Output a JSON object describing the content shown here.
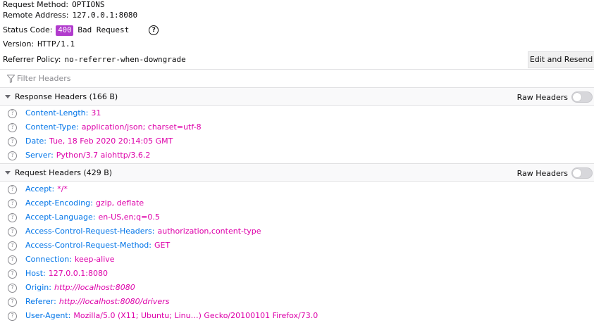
{
  "summary": {
    "request_method": {
      "label": "Request Method:",
      "value": "OPTIONS"
    },
    "remote_address": {
      "label": "Remote Address:",
      "value": "127.0.0.1:8080"
    },
    "status": {
      "label": "Status Code:",
      "code": "400",
      "text": "Bad Request",
      "help": "?"
    },
    "version": {
      "label": "Version:",
      "value": "HTTP/1.1"
    },
    "referrer_policy": {
      "label": "Referrer Policy:",
      "value": "no-referrer-when-downgrade"
    },
    "edit_resend_label": "Edit and Resend"
  },
  "filter": {
    "placeholder": "Filter Headers"
  },
  "response_section": {
    "title": "Response Headers (166 B)",
    "raw_label": "Raw Headers",
    "raw_enabled": false,
    "headers": [
      {
        "name": "Content-Length",
        "value": "31"
      },
      {
        "name": "Content-Type",
        "value": "application/json; charset=utf-8"
      },
      {
        "name": "Date",
        "value": "Tue, 18 Feb 2020 20:14:05 GMT"
      },
      {
        "name": "Server",
        "value": "Python/3.7 aiohttp/3.6.2"
      }
    ]
  },
  "request_section": {
    "title": "Request Headers (429 B)",
    "raw_label": "Raw Headers",
    "raw_enabled": false,
    "headers": [
      {
        "name": "Accept",
        "value": "*/*"
      },
      {
        "name": "Accept-Encoding",
        "value": "gzip, deflate"
      },
      {
        "name": "Accept-Language",
        "value": "en-US,en;q=0.5"
      },
      {
        "name": "Access-Control-Request-Headers",
        "value": "authorization,content-type"
      },
      {
        "name": "Access-Control-Request-Method",
        "value": "GET"
      },
      {
        "name": "Connection",
        "value": "keep-alive"
      },
      {
        "name": "Host",
        "value": "127.0.0.1:8080"
      },
      {
        "name": "Origin",
        "value": "http://localhost:8080"
      },
      {
        "name": "Referer",
        "value": "http://localhost:8080/drivers"
      },
      {
        "name": "User-Agent",
        "value": "Mozilla/5.0 (X11; Ubuntu; Linu…) Gecko/20100101 Firefox/73.0"
      }
    ]
  },
  "colors": {
    "header_name": "#0074e8",
    "header_value": "#dd00a9",
    "status_badge": "#b13bcd"
  }
}
